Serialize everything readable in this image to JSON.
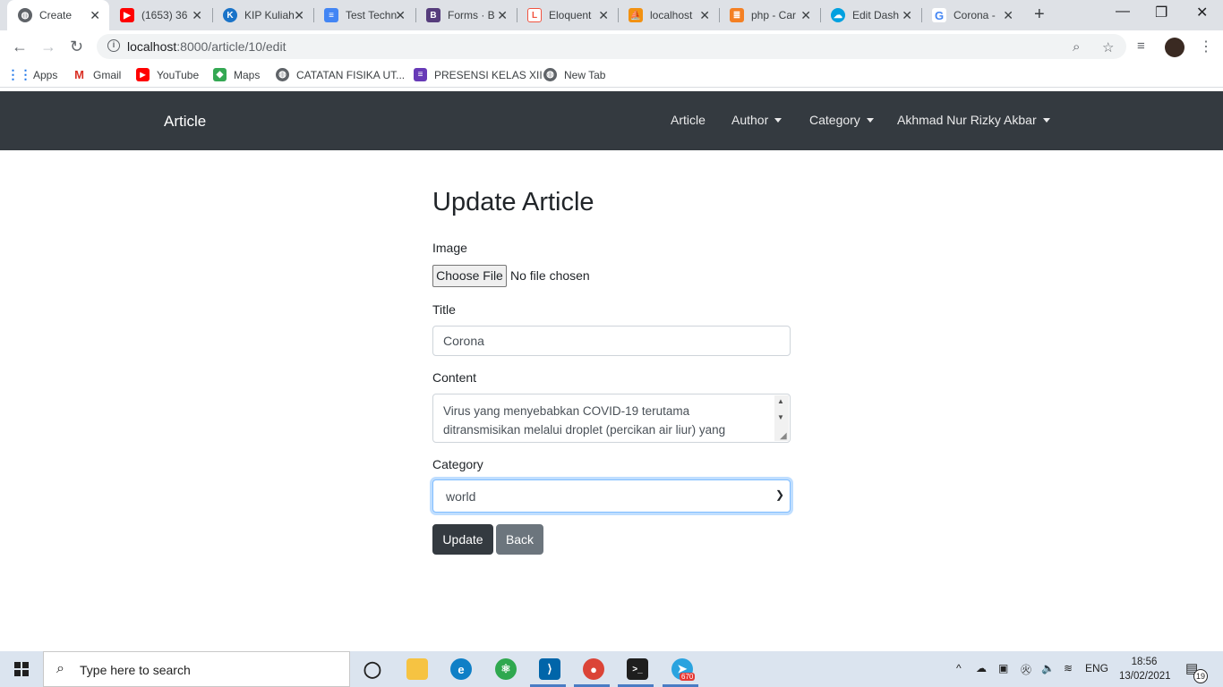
{
  "browser": {
    "tabs": [
      {
        "title": "Create",
        "favicon": "globe-icon",
        "active": true
      },
      {
        "title": "(1653) 36",
        "favicon": "youtube-icon"
      },
      {
        "title": "KIP Kuliah",
        "favicon": "kip-icon"
      },
      {
        "title": "Test Techn",
        "favicon": "docs-icon"
      },
      {
        "title": "Forms · B",
        "favicon": "bootstrap-icon"
      },
      {
        "title": "Eloquent",
        "favicon": "laravel-icon"
      },
      {
        "title": "localhost",
        "favicon": "phpmyadmin-icon"
      },
      {
        "title": "php - Car",
        "favicon": "stackoverflow-icon"
      },
      {
        "title": "Edit Dash",
        "favicon": "salesforce-icon"
      },
      {
        "title": "Corona -",
        "favicon": "google-icon"
      }
    ],
    "url_host": "localhost",
    "url_rest": ":8000/article/10/edit",
    "bookmarks": [
      {
        "label": "Apps",
        "icon": "apps-grid-icon"
      },
      {
        "label": "Gmail",
        "icon": "gmail-icon"
      },
      {
        "label": "YouTube",
        "icon": "youtube-icon"
      },
      {
        "label": "Maps",
        "icon": "maps-icon"
      },
      {
        "label": "CATATAN FISIKA UT...",
        "icon": "globe-icon"
      },
      {
        "label": "PRESENSI KELAS XII",
        "icon": "forms-icon"
      },
      {
        "label": "New Tab",
        "icon": "globe-icon"
      }
    ]
  },
  "navbar": {
    "brand": "Article",
    "links": [
      {
        "label": "Article",
        "dropdown": false
      },
      {
        "label": "Author",
        "dropdown": true
      },
      {
        "label": "Category",
        "dropdown": true
      },
      {
        "label": "Akhmad Nur Rizky Akbar",
        "dropdown": true
      }
    ]
  },
  "form": {
    "heading": "Update Article",
    "image_label": "Image",
    "file_button": "Choose File",
    "file_status": "No file chosen",
    "title_label": "Title",
    "title_value": "Corona",
    "content_label": "Content",
    "content_value": "Virus yang menyebabkan COVID-19 terutama ditransmisikan melalui droplet (percikan air liur) yang",
    "category_label": "Category",
    "category_value": "world",
    "update_button": "Update",
    "back_button": "Back"
  },
  "taskbar": {
    "search_placeholder": "Type here to search",
    "language": "ENG",
    "time": "18:56",
    "date": "13/02/2021",
    "notification_count": "19",
    "telegram_badge": "670"
  }
}
